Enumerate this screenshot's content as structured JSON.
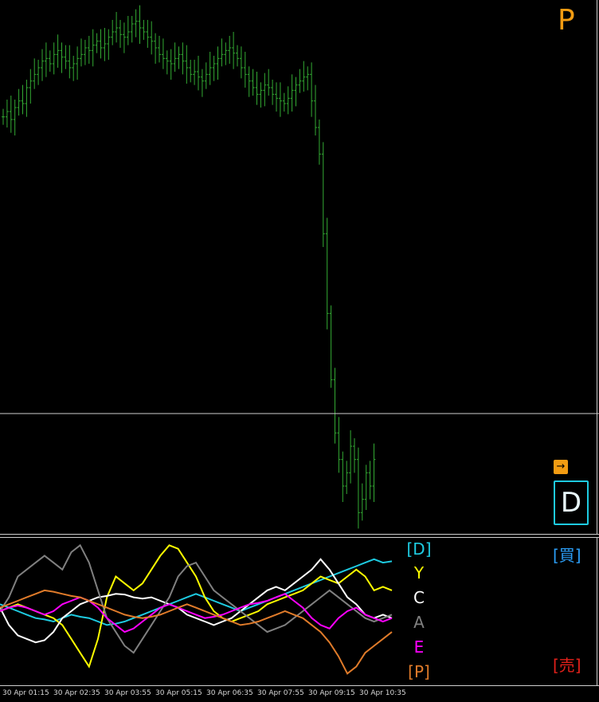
{
  "overlay": {
    "corner_label": "P",
    "arrow_symbol": "→",
    "mode_button": "D",
    "buy_label": "[買]",
    "sell_label": "[売]",
    "legend": [
      {
        "text": "[D]",
        "color": "#1ecbe1"
      },
      {
        "text": "Y",
        "color": "#ffff00"
      },
      {
        "text": "C",
        "color": "#ffffff"
      },
      {
        "text": "A",
        "color": "#808080"
      },
      {
        "text": "E",
        "color": "#ff00ff"
      },
      {
        "text": "[P]",
        "color": "#e07b2a"
      }
    ],
    "colors": {
      "candle": "#33aa33",
      "accent": "#f39c12",
      "grid": "#cfcfcf"
    }
  },
  "chart_data": [
    {
      "type": "bar",
      "price_bars": [
        48,
        52,
        46,
        55,
        60,
        58,
        70,
        75,
        80,
        85,
        90,
        92,
        88,
        95,
        98,
        93,
        90,
        85,
        88,
        92,
        95,
        100,
        98,
        102,
        105,
        100,
        103,
        108,
        112,
        115,
        110,
        108,
        112,
        118,
        120,
        115,
        112,
        108,
        105,
        100,
        95,
        92,
        90,
        88,
        92,
        95,
        90,
        85,
        80,
        82,
        78,
        75,
        80,
        85,
        88,
        92,
        95,
        98,
        100,
        96,
        92,
        85,
        80,
        75,
        70,
        65,
        68,
        72,
        70,
        65,
        62,
        60,
        58,
        62,
        68,
        72,
        75,
        78,
        80,
        60,
        40,
        20,
        -40,
        -100,
        -150,
        -190,
        -210,
        -230,
        -220,
        -200,
        -210,
        -250,
        -240,
        -220,
        -230,
        -210
      ],
      "y_range": [
        -260,
        130
      ],
      "x_ticks": [
        "30 Apr 01:15",
        "30 Apr 02:35",
        "30 Apr 03:55",
        "30 Apr 05:15",
        "30 Apr 06:35",
        "30 Apr 07:55",
        "30 Apr 09:15",
        "30 Apr 10:35"
      ]
    },
    {
      "type": "line",
      "y_range": [
        -1,
        1
      ],
      "series": [
        {
          "name": "D",
          "color": "#1ecbe1",
          "values": [
            0.1,
            0.05,
            0.0,
            -0.05,
            -0.1,
            -0.12,
            -0.15,
            -0.1,
            -0.05,
            -0.08,
            -0.1,
            -0.15,
            -0.2,
            -0.18,
            -0.15,
            -0.1,
            -0.05,
            0.0,
            0.05,
            0.1,
            0.15,
            0.2,
            0.25,
            0.2,
            0.15,
            0.1,
            0.05,
            0.0,
            0.05,
            0.1,
            0.15,
            0.2,
            0.25,
            0.3,
            0.35,
            0.4,
            0.45,
            0.5,
            0.55,
            0.6,
            0.65,
            0.7,
            0.75,
            0.7,
            0.72
          ]
        },
        {
          "name": "Y",
          "color": "#ffff00",
          "values": [
            0.0,
            0.05,
            0.1,
            0.05,
            0.0,
            -0.05,
            -0.1,
            -0.2,
            -0.4,
            -0.6,
            -0.8,
            -0.4,
            0.2,
            0.5,
            0.4,
            0.3,
            0.4,
            0.6,
            0.8,
            0.95,
            0.9,
            0.7,
            0.5,
            0.2,
            0.0,
            -0.1,
            -0.15,
            -0.1,
            -0.05,
            0.0,
            0.1,
            0.15,
            0.2,
            0.25,
            0.3,
            0.4,
            0.5,
            0.45,
            0.4,
            0.5,
            0.6,
            0.5,
            0.3,
            0.35,
            0.3
          ]
        },
        {
          "name": "C",
          "color": "#ffffff",
          "values": [
            0.05,
            -0.2,
            -0.35,
            -0.4,
            -0.45,
            -0.42,
            -0.3,
            -0.1,
            0.0,
            0.1,
            0.15,
            0.2,
            0.22,
            0.25,
            0.24,
            0.2,
            0.18,
            0.2,
            0.15,
            0.1,
            0.05,
            -0.05,
            -0.1,
            -0.15,
            -0.2,
            -0.15,
            -0.1,
            0.0,
            0.1,
            0.2,
            0.3,
            0.35,
            0.3,
            0.4,
            0.5,
            0.6,
            0.75,
            0.6,
            0.4,
            0.2,
            0.1,
            -0.05,
            -0.1,
            -0.05,
            -0.1
          ]
        },
        {
          "name": "A",
          "color": "#808080",
          "values": [
            0.0,
            0.2,
            0.5,
            0.6,
            0.7,
            0.8,
            0.7,
            0.6,
            0.85,
            0.95,
            0.7,
            0.3,
            -0.1,
            -0.3,
            -0.5,
            -0.6,
            -0.4,
            -0.2,
            0.0,
            0.2,
            0.5,
            0.65,
            0.7,
            0.5,
            0.3,
            0.2,
            0.1,
            0.0,
            -0.1,
            -0.2,
            -0.3,
            -0.25,
            -0.2,
            -0.1,
            0.0,
            0.1,
            0.2,
            0.3,
            0.2,
            0.1,
            0.0,
            -0.1,
            -0.15,
            -0.1,
            -0.05
          ]
        },
        {
          "name": "E",
          "color": "#ff00ff",
          "values": [
            0.0,
            0.05,
            0.08,
            0.05,
            0.0,
            -0.05,
            0.0,
            0.1,
            0.15,
            0.2,
            0.15,
            0.05,
            -0.1,
            -0.2,
            -0.3,
            -0.25,
            -0.15,
            -0.05,
            0.05,
            0.1,
            0.05,
            0.0,
            -0.05,
            -0.1,
            -0.08,
            -0.05,
            0.0,
            0.05,
            0.1,
            0.12,
            0.15,
            0.2,
            0.25,
            0.15,
            0.05,
            -0.1,
            -0.2,
            -0.25,
            -0.1,
            0.0,
            0.05,
            -0.05,
            -0.1,
            -0.15,
            -0.1
          ]
        },
        {
          "name": "P",
          "color": "#e07b2a",
          "values": [
            0.05,
            0.1,
            0.15,
            0.2,
            0.25,
            0.3,
            0.28,
            0.25,
            0.22,
            0.2,
            0.15,
            0.1,
            0.05,
            0.0,
            -0.05,
            -0.08,
            -0.1,
            -0.08,
            -0.05,
            0.0,
            0.05,
            0.1,
            0.05,
            0.0,
            -0.05,
            -0.1,
            -0.15,
            -0.2,
            -0.18,
            -0.15,
            -0.1,
            -0.05,
            0.0,
            -0.05,
            -0.1,
            -0.2,
            -0.3,
            -0.45,
            -0.65,
            -0.9,
            -0.8,
            -0.6,
            -0.5,
            -0.4,
            -0.3
          ]
        }
      ]
    }
  ]
}
